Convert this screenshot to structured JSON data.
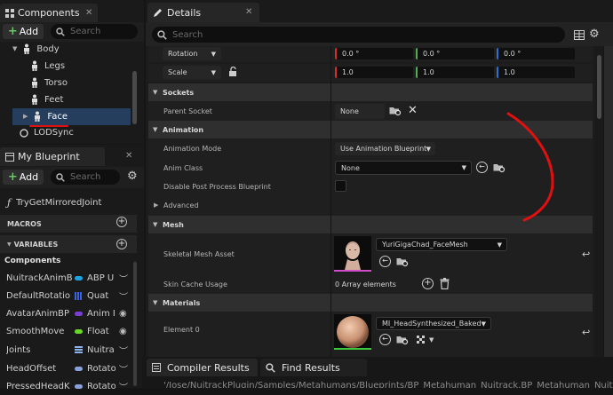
{
  "components": {
    "tab": "Components",
    "add": "Add",
    "search_placeholder": "Search",
    "tree": [
      "Body",
      "Legs",
      "Torso",
      "Feet",
      "Face",
      "LODSync"
    ]
  },
  "my_blueprint": {
    "tab": "My Blueprint",
    "add": "Add",
    "search_placeholder": "Search",
    "function": "TryGetMirroredJoint",
    "macros": "MACROS",
    "variables": "VARIABLES",
    "components_label": "Components",
    "vars": [
      {
        "name": "NuitrackAnimB",
        "type": "ABP U",
        "color": "#1fa1e0"
      },
      {
        "name": "DefaultRotatio",
        "type": "Quat",
        "color": "#3a63e3"
      },
      {
        "name": "AvatarAnimBP",
        "type": "Anim I",
        "color": "#7a3fd0"
      },
      {
        "name": "SmoothMove",
        "type": "Float",
        "color": "#6ad62a"
      },
      {
        "name": "Joints",
        "type": "Nuitra",
        "color": "#8fb0e8"
      },
      {
        "name": "HeadOffset",
        "type": "Rotato",
        "color": "#8aa0d8"
      },
      {
        "name": "PressedHeadK",
        "type": "Rotato",
        "color": "#8aa0d8"
      }
    ]
  },
  "details": {
    "tab": "Details",
    "search_placeholder": "Search",
    "rotation": {
      "label": "Rotation",
      "x": "0.0 °",
      "y": "0.0 °",
      "z": "0.0 °"
    },
    "scale": {
      "label": "Scale",
      "x": "1.0",
      "y": "1.0",
      "z": "1.0"
    },
    "sockets": {
      "title": "Sockets",
      "parent_socket": "Parent Socket",
      "value": "None"
    },
    "animation": {
      "title": "Animation",
      "mode_label": "Animation Mode",
      "mode_value": "Use Animation Blueprint",
      "class_label": "Anim Class",
      "class_value": "None",
      "disable_pp": "Disable Post Process Blueprint",
      "advanced": "Advanced"
    },
    "mesh": {
      "title": "Mesh",
      "asset_label": "Skeletal Mesh Asset",
      "asset_value": "YuriGigaChad_FaceMesh",
      "skin_cache": "Skin Cache Usage",
      "skin_cache_value": "0 Array elements"
    },
    "materials": {
      "title": "Materials",
      "element0": "Element 0",
      "element0_value": "MI_HeadSynthesized_Baked"
    }
  },
  "bottom": {
    "compiler": "Compiler Results",
    "find": "Find Results",
    "path": "'/Jose/NuitrackPlugin/Samples/Metahumans/Blueprints/BP_Metahuman_Nuitrack.BP_Metahuman_Nuitrack'"
  }
}
